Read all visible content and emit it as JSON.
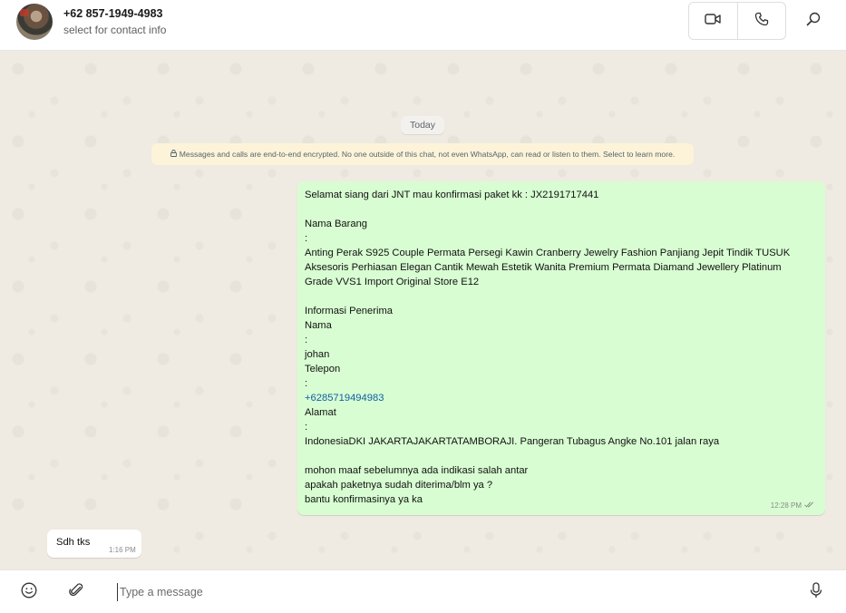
{
  "header": {
    "contact_name": "+62 857-1949-4983",
    "contact_subtitle": "select for contact info",
    "video_icon": "video-call-icon",
    "voice_icon": "voice-call-icon",
    "search_icon": "search-icon"
  },
  "chat": {
    "date_chip": "Today",
    "encryption_notice": "Messages and calls are end-to-end encrypted. No one outside of this chat, not even WhatsApp, can read or listen to them. Select to learn more.",
    "outgoing_message": {
      "lines": [
        "Selamat siang dari JNT mau konfirmasi paket kk : JX2191717441",
        "",
        "Nama Barang",
        ":",
        "Anting Perak S925 Couple Permata Persegi Kawin Cranberry Jewelry Fashion Panjiang Jepit Tindik TUSUK",
        "Aksesoris Perhiasan Elegan Cantik Mewah Estetik Wanita Premium Permata Diamand Jewellery Platinum",
        "Grade VVS1 Import Original Store E12",
        "",
        "Informasi Penerima",
        "Nama",
        ":",
        "johan",
        "Telepon",
        ":",
        "+6285719494983",
        "Alamat",
        ":",
        "IndonesiaDKI JAKARTAJAKARTATAMBORAJI. Pangeran Tubagus Angke No.101 jalan raya",
        "",
        "mohon maaf sebelumnya ada indikasi salah antar",
        "apakah paketnya sudah diterima/blm ya ?",
        "bantu konfirmasinya ya ka"
      ],
      "time": "12:28 PM",
      "status": "read"
    },
    "incoming_message": {
      "text": "Sdh tks",
      "time": "1:16 PM"
    }
  },
  "composer": {
    "placeholder": "Type a message",
    "value": "",
    "emoji_icon": "emoji-icon",
    "attach_icon": "paperclip-icon",
    "mic_icon": "microphone-icon"
  },
  "colors": {
    "outgoing_bubble": "#d8fdd2",
    "incoming_bubble": "#ffffff",
    "chat_background": "#efeae2",
    "encryption_notice_bg": "#fdf3d8",
    "link": "#0f5fa6"
  }
}
